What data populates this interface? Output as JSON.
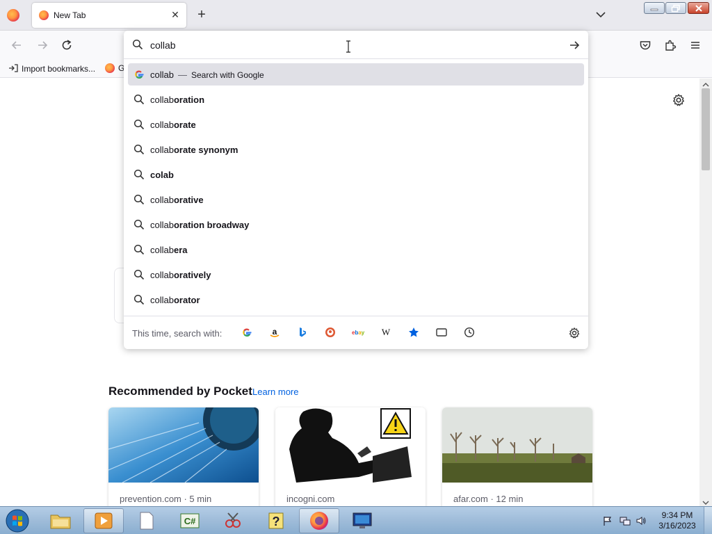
{
  "browser": {
    "tab": {
      "title": "New Tab",
      "close_glyph": "✕"
    },
    "new_tab_glyph": "+"
  },
  "bookmarks": {
    "import_label": "Import bookmarks...",
    "getting_started_label": "G"
  },
  "urlbar": {
    "value": "collab",
    "heuristic": {
      "query": "collab",
      "separator": "—",
      "action": "Search with Google"
    },
    "suggestions": [
      {
        "prefix": "collab",
        "bold": "oration"
      },
      {
        "prefix": "collab",
        "bold": "orate"
      },
      {
        "prefix": "collab",
        "bold": "orate synonym"
      },
      {
        "prefix": "",
        "bold": "colab"
      },
      {
        "prefix": "collab",
        "bold": "orative"
      },
      {
        "prefix": "collab",
        "bold": "oration broadway"
      },
      {
        "prefix": "collab",
        "bold": "era"
      },
      {
        "prefix": "collab",
        "bold": "oratively"
      },
      {
        "prefix": "collab",
        "bold": "orator"
      }
    ],
    "one_off_label": "This time, search with:",
    "engines": [
      "google-icon",
      "amazon-icon",
      "bing-icon",
      "duckduckgo-icon",
      "ebay-icon",
      "wikipedia-icon",
      "bookmarks-icon",
      "tabs-icon",
      "history-icon"
    ]
  },
  "pocket": {
    "heading": "Recommended by Pocket",
    "learn_more": "Learn more",
    "cards": [
      {
        "source": "prevention.com · 5 min",
        "thumb": "shower-water-image"
      },
      {
        "source": "incogni.com",
        "thumb": "woman-laptop-warning-image"
      },
      {
        "source": "afar.com · 12 min",
        "thumb": "landscape-trees-image"
      }
    ]
  },
  "taskbar": {
    "time": "9:34 PM",
    "date": "3/16/2023"
  },
  "colors": {
    "accent_link": "#0061e0",
    "selected_row": "#e0e0e6",
    "tab_strip": "#e9e9ee"
  }
}
